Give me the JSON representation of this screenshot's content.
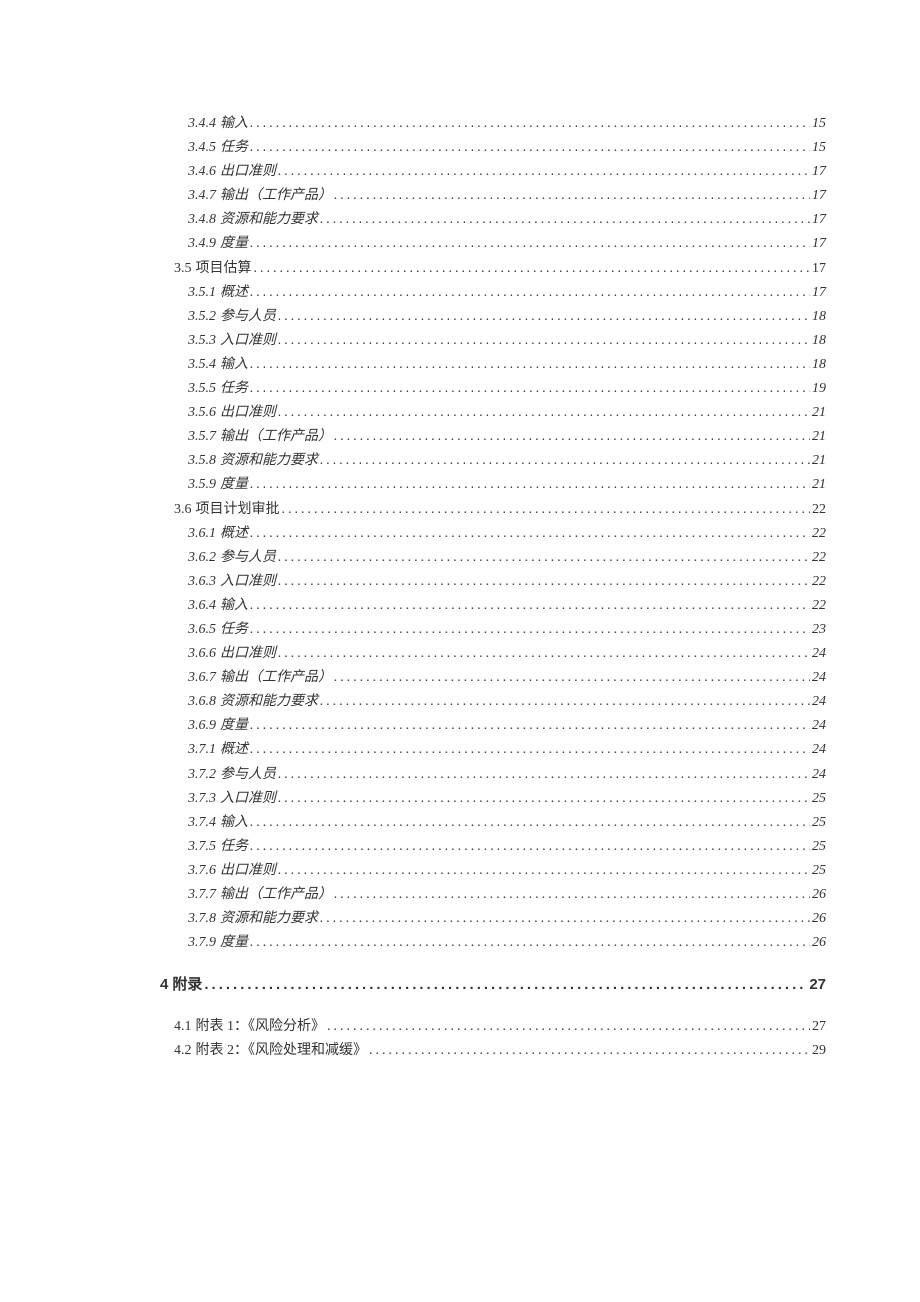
{
  "toc": [
    {
      "level": 3,
      "num": "3.4.4",
      "title": "输入",
      "page": "15",
      "spaced": false
    },
    {
      "level": 3,
      "num": "3.4.5",
      "title": "任务",
      "page": "15",
      "spaced": false
    },
    {
      "level": 3,
      "num": "3.4.6",
      "title": "出口准则",
      "page": "17",
      "spaced": false
    },
    {
      "level": 3,
      "num": "3.4.7",
      "title": "输出（工作产品）",
      "page": "17",
      "spaced": false
    },
    {
      "level": 3,
      "num": "3.4.8",
      "title": "资源和能力要求",
      "page": "17",
      "spaced": false
    },
    {
      "level": 3,
      "num": "3.4.9",
      "title": "度量",
      "page": "17",
      "spaced": false
    },
    {
      "level": 2,
      "num": "3.5",
      "title": "项目估算",
      "page": "17",
      "spaced": false
    },
    {
      "level": 3,
      "num": "3.5.1",
      "title": "概述",
      "page": "17",
      "spaced": false
    },
    {
      "level": 3,
      "num": "3.5.2",
      "title": "参与人员",
      "page": "18",
      "spaced": false
    },
    {
      "level": 3,
      "num": "3.5.3",
      "title": "入口准则",
      "page": "18",
      "spaced": false
    },
    {
      "level": 3,
      "num": "3.5.4",
      "title": "输入",
      "page": "18",
      "spaced": false
    },
    {
      "level": 3,
      "num": "3.5.5",
      "title": "任务",
      "page": "19",
      "spaced": false
    },
    {
      "level": 3,
      "num": "3.5.6",
      "title": "出口准则",
      "page": "21",
      "spaced": false
    },
    {
      "level": 3,
      "num": "3.5.7",
      "title": "输出（工作产品）",
      "page": "21",
      "spaced": false
    },
    {
      "level": 3,
      "num": "3.5.8",
      "title": "资源和能力要求",
      "page": "21",
      "spaced": false
    },
    {
      "level": 3,
      "num": "3.5.9",
      "title": "度量",
      "page": "21",
      "spaced": false
    },
    {
      "level": 2,
      "num": "3.6",
      "title": "项目计划审批",
      "page": "22",
      "spaced": false
    },
    {
      "level": 3,
      "num": "3.6.1",
      "title": "概述",
      "page": "22",
      "spaced": false
    },
    {
      "level": 3,
      "num": "3.6.2",
      "title": "参与人员",
      "page": "22",
      "spaced": false
    },
    {
      "level": 3,
      "num": "3.6.3",
      "title": "入口准则",
      "page": "22",
      "spaced": false
    },
    {
      "level": 3,
      "num": "3.6.4",
      "title": "输入",
      "page": "22",
      "spaced": false
    },
    {
      "level": 3,
      "num": "3.6.5",
      "title": "任务",
      "page": "23",
      "spaced": false
    },
    {
      "level": 3,
      "num": "3.6.6",
      "title": "出口准则",
      "page": "24",
      "spaced": false
    },
    {
      "level": 3,
      "num": "3.6.7",
      "title": "输出（工作产品）",
      "page": "24",
      "spaced": false
    },
    {
      "level": 3,
      "num": "3.6.8",
      "title": "资源和能力要求",
      "page": "24",
      "spaced": false
    },
    {
      "level": 3,
      "num": "3.6.9",
      "title": "度量",
      "page": "24",
      "spaced": false
    },
    {
      "level": 3,
      "num": "3.7.1",
      "title": "概述",
      "page": "24",
      "spaced": false
    },
    {
      "level": 3,
      "num": "3.7.2",
      "title": "参与人员",
      "page": "24",
      "spaced": false
    },
    {
      "level": 3,
      "num": "3.7.3",
      "title": "入口准则",
      "page": "25",
      "spaced": false
    },
    {
      "level": 3,
      "num": "3.7.4",
      "title": "输入",
      "page": "25",
      "spaced": false
    },
    {
      "level": 3,
      "num": "3.7.5",
      "title": "任务",
      "page": "25",
      "spaced": false
    },
    {
      "level": 3,
      "num": "3.7.6",
      "title": "出口准则",
      "page": "25",
      "spaced": false
    },
    {
      "level": 3,
      "num": "3.7.7",
      "title": "输出（工作产品）",
      "page": "26",
      "spaced": false
    },
    {
      "level": 3,
      "num": "3.7.8",
      "title": "资源和能力要求",
      "page": "26",
      "spaced": false
    },
    {
      "level": 3,
      "num": "3.7.9",
      "title": "度量",
      "page": "26",
      "spaced": false
    },
    {
      "level": 1,
      "num": "4",
      "title": "附录",
      "page": "27",
      "spaced": true
    },
    {
      "level": 2,
      "num": "4.1",
      "title": "附表 1：《风险分析》",
      "page": "27",
      "spaced": true
    },
    {
      "level": 2,
      "num": "4.2",
      "title": "附表 2：《风险处理和减缓》",
      "page": "29",
      "spaced": false
    }
  ]
}
